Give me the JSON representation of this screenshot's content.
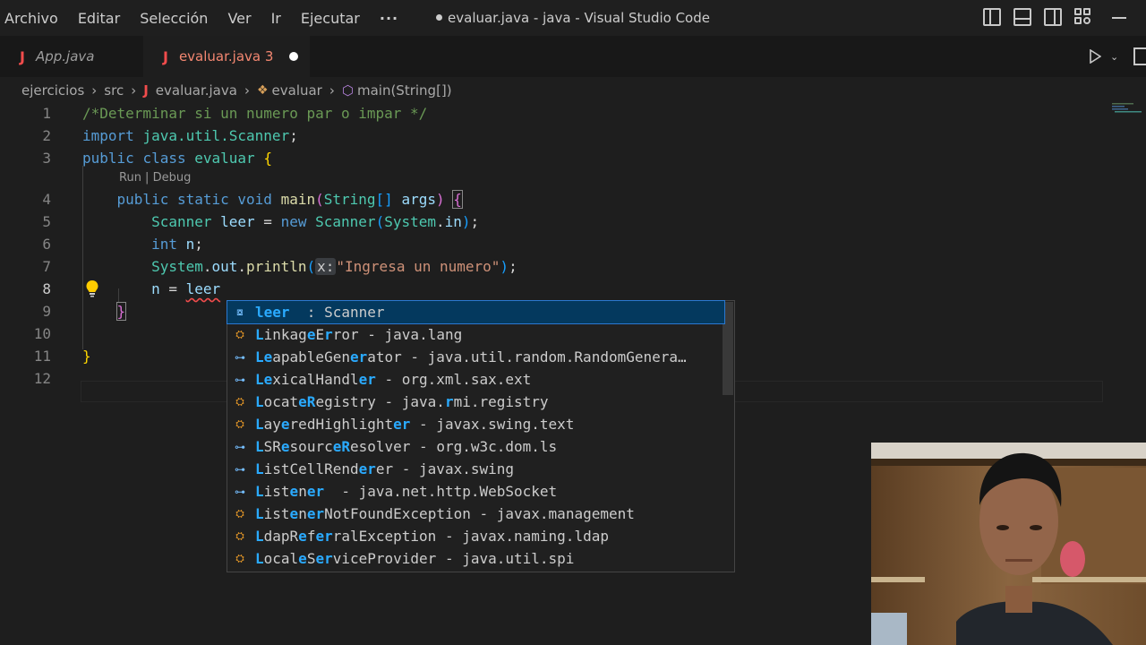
{
  "menu": {
    "items": [
      "Archivo",
      "Editar",
      "Selección",
      "Ver",
      "Ir",
      "Ejecutar",
      "···"
    ]
  },
  "window": {
    "title": "evaluar.java - java - Visual Studio Code"
  },
  "tabs": [
    {
      "label": "App.java",
      "icon": "java-icon"
    },
    {
      "label": "evaluar.java 3",
      "icon": "java-icon",
      "modified": true
    }
  ],
  "breadcrumb": {
    "items": [
      "ejercicios",
      "src",
      "evaluar.java",
      "evaluar",
      "main(String[])"
    ]
  },
  "editor": {
    "line_numbers": [
      "1",
      "2",
      "3",
      "4",
      "5",
      "6",
      "7",
      "8",
      "9",
      "10",
      "11",
      "12"
    ],
    "active_line": "8",
    "codelens": "Run | Debug",
    "lines": {
      "l1": "/*Determinar si un numero par o impar */",
      "l2_import": "import",
      "l2_pkg": "java.util.Scanner",
      "l2_semi": ";",
      "l3_public": "public",
      "l3_class": "class",
      "l3_name": "evaluar",
      "l3_brace": "{",
      "l4_mods": "public static void",
      "l4_fn": "main",
      "l4_paren": "(",
      "l4_type": "String",
      "l4_arr": "[]",
      "l4_arg": "args",
      "l4_close": ")",
      "l4_brace": "{",
      "l5_type": "Scanner",
      "l5_var": "leer",
      "l5_eq": " = ",
      "l5_new": "new",
      "l5_ctor": "Scanner",
      "l5_open": "(",
      "l5_sys": "System",
      "l5_dot": ".",
      "l5_in": "in",
      "l5_close": ")",
      "l5_semi": ";",
      "l6_int": "int",
      "l6_var": "n",
      "l6_semi": ";",
      "l7_sys": "System",
      "l7_out": "out",
      "l7_fn": "println",
      "l7_open": "(",
      "l7_hint": "x:",
      "l7_str": "\"Ingresa un numero\"",
      "l7_close": ")",
      "l7_semi": ";",
      "l8_var": "n",
      "l8_eq": " = ",
      "l8_leer": "leer",
      "l9_brace": "}",
      "l11_brace": "}"
    }
  },
  "suggestions": [
    {
      "icon": "variable-icon",
      "parts": [
        [
          "m",
          "leer"
        ],
        [
          "n",
          "  : Scanner"
        ]
      ]
    },
    {
      "icon": "class-icon",
      "parts": [
        [
          "m",
          "L"
        ],
        [
          "n",
          "inkag"
        ],
        [
          "m",
          "e"
        ],
        [
          "n",
          "E"
        ],
        [
          "m",
          "r"
        ],
        [
          "n",
          "ror - java.lang"
        ]
      ]
    },
    {
      "icon": "interface-icon",
      "parts": [
        [
          "m",
          "Le"
        ],
        [
          "n",
          "apableGen"
        ],
        [
          "m",
          "er"
        ],
        [
          "n",
          "ator - java.util.random.RandomGenera…"
        ]
      ]
    },
    {
      "icon": "interface-icon",
      "parts": [
        [
          "m",
          "Le"
        ],
        [
          "n",
          "xicalHandl"
        ],
        [
          "m",
          "er"
        ],
        [
          "n",
          " - org.xml.sax.ext"
        ]
      ]
    },
    {
      "icon": "class-icon",
      "parts": [
        [
          "m",
          "L"
        ],
        [
          "n",
          "ocat"
        ],
        [
          "m",
          "eR"
        ],
        [
          "n",
          "egistry - java."
        ],
        [
          "m",
          "r"
        ],
        [
          "n",
          "mi.registry"
        ]
      ]
    },
    {
      "icon": "class-icon",
      "parts": [
        [
          "m",
          "L"
        ],
        [
          "n",
          "ay"
        ],
        [
          "m",
          "e"
        ],
        [
          "n",
          "redHighlight"
        ],
        [
          "m",
          "er"
        ],
        [
          "n",
          " - javax.swing.text"
        ]
      ]
    },
    {
      "icon": "interface-icon",
      "parts": [
        [
          "m",
          "L"
        ],
        [
          "n",
          "SR"
        ],
        [
          "m",
          "e"
        ],
        [
          "n",
          "sourc"
        ],
        [
          "m",
          "eR"
        ],
        [
          "n",
          "esolver - org.w3c.dom.ls"
        ]
      ]
    },
    {
      "icon": "interface-icon",
      "parts": [
        [
          "m",
          "L"
        ],
        [
          "n",
          "istCellRend"
        ],
        [
          "m",
          "er"
        ],
        [
          "n",
          "er - javax.swing"
        ]
      ]
    },
    {
      "icon": "interface-icon",
      "parts": [
        [
          "m",
          "L"
        ],
        [
          "n",
          "ist"
        ],
        [
          "m",
          "e"
        ],
        [
          "n",
          "n"
        ],
        [
          "m",
          "er"
        ],
        [
          "n",
          "  - java.net.http.WebSocket"
        ]
      ]
    },
    {
      "icon": "class-icon",
      "parts": [
        [
          "m",
          "L"
        ],
        [
          "n",
          "ist"
        ],
        [
          "m",
          "e"
        ],
        [
          "n",
          "n"
        ],
        [
          "m",
          "er"
        ],
        [
          "n",
          "NotFoundException - javax.management"
        ]
      ]
    },
    {
      "icon": "class-icon",
      "parts": [
        [
          "m",
          "L"
        ],
        [
          "n",
          "dapR"
        ],
        [
          "m",
          "e"
        ],
        [
          "n",
          "f"
        ],
        [
          "m",
          "er"
        ],
        [
          "n",
          "ralException - javax.naming.ldap"
        ]
      ]
    },
    {
      "icon": "class-icon",
      "parts": [
        [
          "m",
          "L"
        ],
        [
          "n",
          "ocal"
        ],
        [
          "m",
          "e"
        ],
        [
          "n",
          "S"
        ],
        [
          "m",
          "er"
        ],
        [
          "n",
          "viceProvider - java.util.spi"
        ]
      ]
    }
  ],
  "colors": {
    "accent": "#04395e",
    "match": "#2aaaff",
    "error": "#f14c4c",
    "keyword": "#569cd6",
    "type": "#4ec9b0",
    "string": "#ce9178",
    "comment": "#6a9955"
  }
}
